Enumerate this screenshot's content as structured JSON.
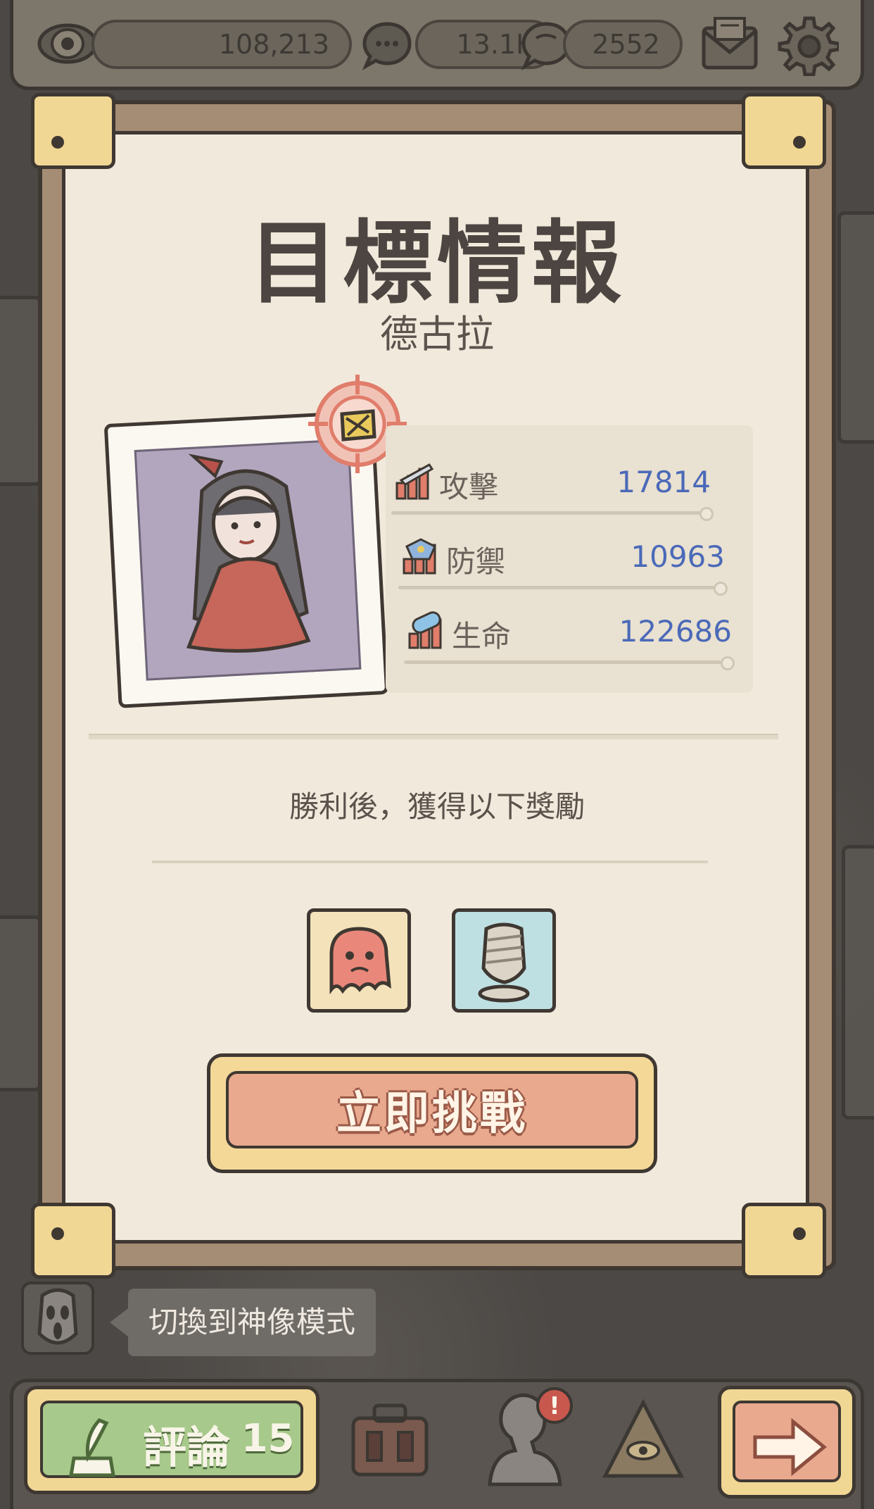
{
  "top_bar": {
    "views": "108,213",
    "comments": "13.1K",
    "replies": "2552"
  },
  "target": {
    "title": "目標情報",
    "name": "德古拉"
  },
  "stats": [
    {
      "label": "攻擊",
      "value": "17814",
      "icon": "sword-attack-icon"
    },
    {
      "label": "防禦",
      "value": "10963",
      "icon": "shield-defense-icon"
    },
    {
      "label": "生命",
      "value": "122686",
      "icon": "pill-health-icon"
    }
  ],
  "rewards": {
    "heading": "勝利後，獲得以下獎勵",
    "items": [
      "ghost-reward-icon",
      "mummy-reward-icon"
    ]
  },
  "challenge_button": "立即挑戰",
  "tooltip": "切換到神像模式",
  "bottom_bar": {
    "comment_label": "評論",
    "comment_count": "15"
  },
  "colors": {
    "stat_value": "#4a69b8",
    "button": "#e8a98e",
    "comment_button": "#a7c98b",
    "panel": "#f1eadc"
  }
}
